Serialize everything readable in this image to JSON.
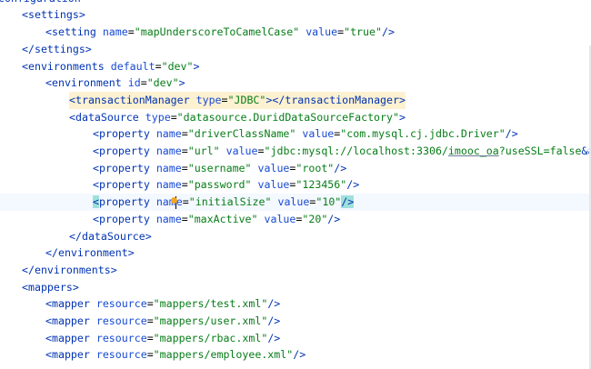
{
  "lines": [
    {
      "indent": 0,
      "parts": [
        {
          "c": "t",
          "k": "tok",
          "s": "configuration"
        }
      ]
    },
    {
      "indent": 1,
      "parts": [
        {
          "c": "t",
          "s": "<settings>"
        }
      ]
    },
    {
      "indent": 2,
      "parts": [
        {
          "c": "t",
          "s": "<setting "
        },
        {
          "c": "a",
          "s": "name"
        },
        {
          "c": "p",
          "s": "="
        },
        {
          "c": "v",
          "s": "\"mapUnderscoreToCamelCase\""
        },
        {
          "c": "p",
          "s": " "
        },
        {
          "c": "a",
          "s": "value"
        },
        {
          "c": "p",
          "s": "="
        },
        {
          "c": "v",
          "s": "\"true\""
        },
        {
          "c": "t",
          "s": "/>"
        }
      ]
    },
    {
      "indent": 1,
      "parts": [
        {
          "c": "t",
          "s": "</settings>"
        }
      ]
    },
    {
      "indent": 1,
      "parts": [
        {
          "c": "t",
          "s": "<environments "
        },
        {
          "c": "a",
          "s": "default"
        },
        {
          "c": "p",
          "s": "="
        },
        {
          "c": "v",
          "s": "\"dev\""
        },
        {
          "c": "t",
          "s": ">"
        }
      ]
    },
    {
      "indent": 2,
      "parts": [
        {
          "c": "t",
          "s": "<environment "
        },
        {
          "c": "a",
          "s": "id"
        },
        {
          "c": "p",
          "s": "="
        },
        {
          "c": "v",
          "s": "\"dev\""
        },
        {
          "c": "t",
          "s": ">"
        }
      ]
    },
    {
      "indent": 3,
      "hl": "tm",
      "parts": [
        {
          "c": "t",
          "s": "<transactionManager "
        },
        {
          "c": "a",
          "s": "type"
        },
        {
          "c": "p",
          "s": "="
        },
        {
          "c": "v",
          "s": "\"JDBC\""
        },
        {
          "c": "t",
          "s": "></transactionManager>"
        }
      ]
    },
    {
      "indent": 3,
      "parts": [
        {
          "c": "t",
          "s": "<dataSource "
        },
        {
          "c": "a",
          "s": "type"
        },
        {
          "c": "p",
          "s": "="
        },
        {
          "c": "v",
          "s": "\"datasource.DuridDataSourceFactory\""
        },
        {
          "c": "t",
          "s": ">"
        }
      ]
    },
    {
      "indent": 4,
      "parts": [
        {
          "c": "t",
          "s": "<property "
        },
        {
          "c": "a",
          "s": "name"
        },
        {
          "c": "p",
          "s": "="
        },
        {
          "c": "v",
          "s": "\"driverClassName\""
        },
        {
          "c": "p",
          "s": " "
        },
        {
          "c": "a",
          "s": "value"
        },
        {
          "c": "p",
          "s": "="
        },
        {
          "c": "v",
          "s": "\"com.mysql.cj.jdbc.Driver\""
        },
        {
          "c": "t",
          "s": "/>"
        }
      ]
    },
    {
      "indent": 4,
      "parts": [
        {
          "c": "t",
          "s": "<property "
        },
        {
          "c": "a",
          "s": "name"
        },
        {
          "c": "p",
          "s": "="
        },
        {
          "c": "v",
          "s": "\"url\""
        },
        {
          "c": "p",
          "s": " "
        },
        {
          "c": "a",
          "s": "value"
        },
        {
          "c": "p",
          "s": "="
        },
        {
          "c": "v",
          "s": "\"jdbc:mysql://localhost:3306/"
        },
        {
          "c": "v u",
          "s": "imooc_oa"
        },
        {
          "c": "v",
          "s": "?useSSL=false"
        },
        {
          "c": "e",
          "s": "&amp;"
        },
        {
          "c": "v",
          "s": "us"
        }
      ]
    },
    {
      "indent": 4,
      "parts": [
        {
          "c": "t",
          "s": "<property "
        },
        {
          "c": "a",
          "s": "name"
        },
        {
          "c": "p",
          "s": "="
        },
        {
          "c": "v",
          "s": "\"username\""
        },
        {
          "c": "p",
          "s": " "
        },
        {
          "c": "a",
          "s": "value"
        },
        {
          "c": "p",
          "s": "="
        },
        {
          "c": "v",
          "s": "\"root\""
        },
        {
          "c": "t",
          "s": "/>"
        }
      ]
    },
    {
      "indent": 4,
      "parts": [
        {
          "c": "t",
          "s": "<property "
        },
        {
          "c": "a",
          "s": "name"
        },
        {
          "c": "p",
          "s": "="
        },
        {
          "c": "v",
          "s": "\"password\""
        },
        {
          "c": "p",
          "s": " "
        },
        {
          "c": "a",
          "s": "value"
        },
        {
          "c": "p",
          "s": "="
        },
        {
          "c": "v",
          "s": "\"123456\""
        },
        {
          "c": "t",
          "s": "/>"
        }
      ]
    },
    {
      "indent": 4,
      "current": true,
      "parts": [
        {
          "c": "t brace-hl",
          "s": "<"
        },
        {
          "c": "t",
          "s": "property "
        },
        {
          "c": "a",
          "s": "nam"
        },
        {
          "c": "caret",
          "s": ""
        },
        {
          "c": "a",
          "s": "e"
        },
        {
          "c": "p",
          "s": "="
        },
        {
          "c": "v",
          "s": "\"initialSize\""
        },
        {
          "c": "p",
          "s": " "
        },
        {
          "c": "a",
          "s": "value"
        },
        {
          "c": "p",
          "s": "="
        },
        {
          "c": "v",
          "s": "\"10\""
        },
        {
          "c": "t brace-hl",
          "s": "/>"
        }
      ]
    },
    {
      "indent": 4,
      "parts": [
        {
          "c": "t",
          "s": "<property "
        },
        {
          "c": "a",
          "s": "name"
        },
        {
          "c": "p",
          "s": "="
        },
        {
          "c": "v",
          "s": "\"maxActive\""
        },
        {
          "c": "p",
          "s": " "
        },
        {
          "c": "a",
          "s": "value"
        },
        {
          "c": "p",
          "s": "="
        },
        {
          "c": "v",
          "s": "\"20\""
        },
        {
          "c": "t",
          "s": "/>"
        }
      ]
    },
    {
      "indent": 3,
      "parts": [
        {
          "c": "t",
          "s": "</dataSource>"
        }
      ]
    },
    {
      "indent": 2,
      "parts": [
        {
          "c": "t",
          "s": "</environment>"
        }
      ]
    },
    {
      "indent": 1,
      "parts": [
        {
          "c": "t",
          "s": "</environments>"
        }
      ]
    },
    {
      "indent": 1,
      "parts": [
        {
          "c": "t",
          "s": "<mappers>"
        }
      ]
    },
    {
      "indent": 2,
      "parts": [
        {
          "c": "t",
          "s": "<mapper "
        },
        {
          "c": "a",
          "s": "resource"
        },
        {
          "c": "p",
          "s": "="
        },
        {
          "c": "v",
          "s": "\"mappers/test.xml\""
        },
        {
          "c": "t",
          "s": "/>"
        }
      ]
    },
    {
      "indent": 2,
      "parts": [
        {
          "c": "t",
          "s": "<mapper "
        },
        {
          "c": "a",
          "s": "resource"
        },
        {
          "c": "p",
          "s": "="
        },
        {
          "c": "v",
          "s": "\"mappers/user.xml\""
        },
        {
          "c": "t",
          "s": "/>"
        }
      ]
    },
    {
      "indent": 2,
      "parts": [
        {
          "c": "t",
          "s": "<mapper "
        },
        {
          "c": "a",
          "s": "resource"
        },
        {
          "c": "p",
          "s": "="
        },
        {
          "c": "v",
          "s": "\"mappers/rbac.xml\""
        },
        {
          "c": "t",
          "s": "/>"
        }
      ]
    },
    {
      "indent": 2,
      "parts": [
        {
          "c": "t",
          "s": "<mapper "
        },
        {
          "c": "a",
          "s": "resource"
        },
        {
          "c": "p",
          "s": "="
        },
        {
          "c": "v",
          "s": "\"mappers/employee.xml\""
        },
        {
          "c": "t",
          "s": "/>"
        }
      ]
    }
  ],
  "icons": {
    "intention": "intention-bulb-icon"
  },
  "colors": {
    "tag": "#0033b3",
    "attr": "#174ad4",
    "value": "#067d17",
    "current_line": "#f4f8ff",
    "highlight": "#fcf1d0",
    "brace_match": "#9ee0dc"
  }
}
